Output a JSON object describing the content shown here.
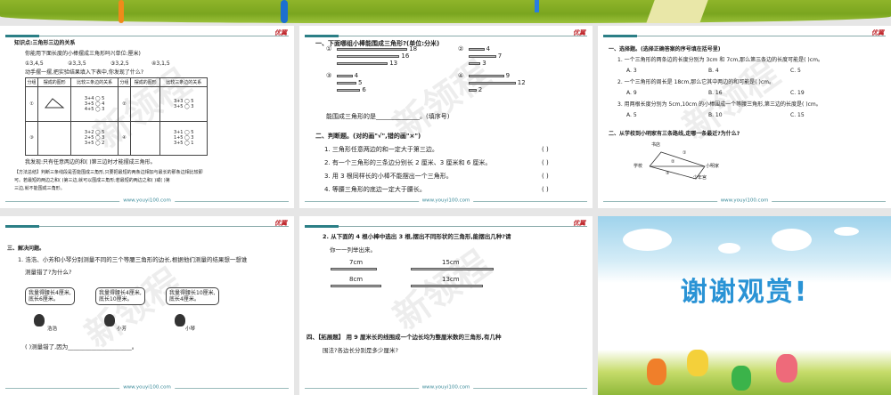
{
  "footer": "www.youyi100.com",
  "logo": "优翼",
  "slide1": {
    "title": "知识点:三角形三边的关系",
    "q": "你能用下面长度的小棒摆成三角形吗?(单位:厘米)",
    "opts": [
      "①3,4,5",
      "②3,3,5",
      "③3,2,5",
      "④3,1,5"
    ],
    "instr": "动手摆一摆,把实验结果填入下表中,你发现了什么?",
    "headers": [
      "分组",
      "摆成的图形",
      "比较三条边的关系",
      "分组",
      "摆成的图形",
      "比较三条边的关系"
    ],
    "groups": [
      "①",
      "②",
      "③",
      "④"
    ],
    "rel1": [
      "3+4 ◯ 5",
      "3+5 ◯ 4",
      "4+5 ◯ 3"
    ],
    "rel2": [
      "3+3 ◯ 5",
      "3+5 ◯ 3"
    ],
    "rel3": [
      "3+2 ◯ 5",
      "2+5 ◯ 3",
      "3+5 ◯ 2"
    ],
    "rel4": [
      "3+1 ◯ 5",
      "1+5 ◯ 3",
      "3+5 ◯ 1"
    ],
    "tri_labels": [
      "3",
      "4",
      "5"
    ],
    "found": "我发现:只有任意两边的和(      )第三边时才能摆成三角形。",
    "method1": "【方法总结】判断三条线段是否能围成三角形,只要把最短的两条边相加与最长的那条边相比较即",
    "method2": "可。若最短的两边之和(      )第三边,就可以围成三角形;若最短的两边之和(      )或(      )第",
    "method3": "三边,就不能围成三角形。"
  },
  "slide2": {
    "h1": "一、下面哪组小棒能围成三角形?(单位:分米)",
    "groups": [
      {
        "label": "①",
        "sticks": [
          18,
          16,
          13
        ]
      },
      {
        "label": "②",
        "sticks": [
          4,
          7,
          3
        ]
      },
      {
        "label": "③",
        "sticks": [
          4,
          5,
          6
        ]
      },
      {
        "label": "④",
        "sticks": [
          9,
          12,
          2
        ]
      }
    ],
    "answer": "能围成三角形的是______________。(填序号)",
    "h2": "二、判断题。(对的画\"√\",错的画\"×\")",
    "items": [
      "1. 三角形任意两边的和一定大于第三边。",
      "2. 有一个三角形的三条边分别长 2 厘米、3 厘米和 6 厘米。",
      "3. 用 3 根同样长的小棒不能摆出一个三角形。",
      "4. 等腰三角形的底边一定大于腰长。"
    ],
    "paren": "(      )"
  },
  "slide3": {
    "h1": "一、选择题。(选择正确答案的序号填在括号里)",
    "qs": [
      {
        "q": "1. 一个三角形的两条边的长度分别为 3cm 和 7cm,那么第三条边的长度可能是(      )cm。",
        "o": [
          "A. 3",
          "B. 4",
          "C. 5"
        ]
      },
      {
        "q": "2. 一个三角形的周长是 18cm,那么它其中两边的和可能是(      )cm。",
        "o": [
          "A. 9",
          "B. 16",
          "C. 19"
        ]
      },
      {
        "q": "3. 用两根长度分别为 5cm,10cm 的小棒围成一个等腰三角形,第三边的长度是(      )cm。",
        "o": [
          "A. 5",
          "B. 10",
          "C. 15"
        ]
      }
    ],
    "h2": "二、从学校到小明家有三条路线,走哪一条最近?为什么?",
    "map": {
      "bookstore": "书店",
      "school": "学校",
      "home": "小明家",
      "youth": "少年宫",
      "r1": "①",
      "r2": "②",
      "r3": "③"
    }
  },
  "slide4": {
    "h": "三、解决问题。",
    "q1": "1. 浩浩、小芳和小琴分别测量不同的三个等腰三角形的边长,根据他们测量的结果想一想谁",
    "q2": "测量错了?为什么?",
    "bubbles": [
      [
        "我量得腰长4厘米,",
        "底长6厘米。"
      ],
      [
        "我量得腰长4厘米,",
        "底长10厘米。"
      ],
      [
        "我量得腰长10厘米,",
        "底长4厘米。"
      ]
    ],
    "names": [
      "浩浩",
      "小芳",
      "小琴"
    ],
    "answer": "(      )测量错了,因为______________________。"
  },
  "slide5": {
    "q1": "2. 从下面的 4 根小棒中选出 3 根,摆出不同形状的三角形,能摆出几种?请",
    "q2": "你一一列举出来。",
    "sticks": [
      "7cm",
      "15cm",
      "8cm",
      "13cm"
    ],
    "h1": "四、【拓展题】 用 9 厘米长的线围成一个边长均为整厘米数的三角形,有几种",
    "h2": "围法?各边长分别是多少厘米?"
  },
  "slide6": {
    "title": "谢谢观赏!"
  }
}
